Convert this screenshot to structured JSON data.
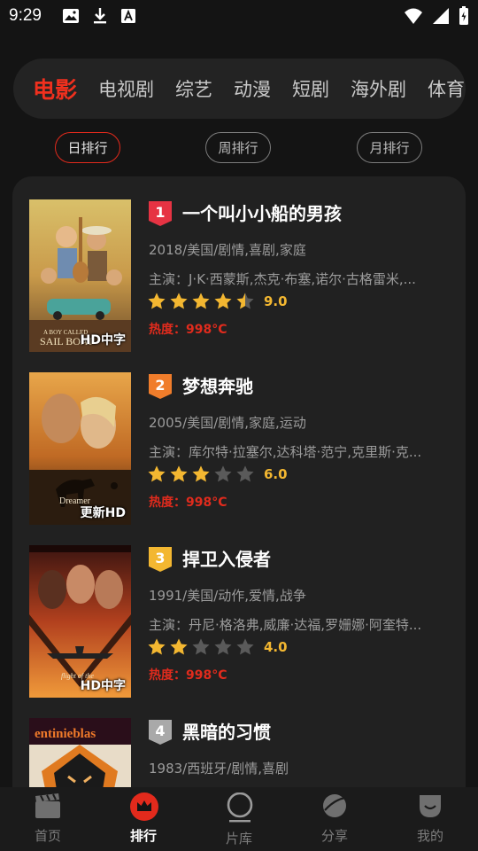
{
  "status_bar": {
    "time": "9:29",
    "left_icons": [
      "image-icon",
      "download-icon",
      "font-icon"
    ],
    "right_icons": [
      "wifi-icon",
      "signal-icon",
      "battery-icon"
    ]
  },
  "categories": {
    "items": [
      "电影",
      "电视剧",
      "综艺",
      "动漫",
      "短剧",
      "海外剧",
      "体育"
    ],
    "active_index": 0
  },
  "periods": {
    "items": [
      "日排行",
      "周排行",
      "月排行"
    ],
    "active_index": 0
  },
  "colors": {
    "accent": "#e32a1c",
    "star": "#f3b731",
    "rank1": "#e63343",
    "rank2": "#f07d2b",
    "rank3": "#f3b731",
    "rank4": "#a9a9a9"
  },
  "movies": [
    {
      "rank": "1",
      "title": "一个叫小小船的男孩",
      "meta": "2018/美国/剧情,喜剧,家庭",
      "cast": "主演：J·K·西蒙斯,杰克·布塞,诺尔·古格雷米,...",
      "rating": 4.5,
      "score": "9.0",
      "heat": "热度：998°C",
      "badge": "HD中字"
    },
    {
      "rank": "2",
      "title": "梦想奔驰",
      "meta": "2005/美国/剧情,家庭,运动",
      "cast": "主演：库尔特·拉塞尔,达科塔·范宁,克里斯·克...",
      "rating": 3,
      "score": "6.0",
      "heat": "热度：998°C",
      "badge": "更新HD"
    },
    {
      "rank": "3",
      "title": "捍卫入侵者",
      "meta": "1991/美国/动作,爱情,战争",
      "cast": "主演：丹尼·格洛弗,威廉·达福,罗姗娜·阿奎特...",
      "rating": 2,
      "score": "4.0",
      "heat": "热度：998°C",
      "badge": "HD中字"
    },
    {
      "rank": "4",
      "title": "黑暗的习惯",
      "meta": "1983/西班牙/剧情,喜剧",
      "cast": "",
      "rating": 0,
      "score": "",
      "heat": "",
      "badge": ""
    }
  ],
  "bottom_nav": {
    "items": [
      "首页",
      "排行",
      "片库",
      "分享",
      "我的"
    ],
    "active_index": 1
  }
}
